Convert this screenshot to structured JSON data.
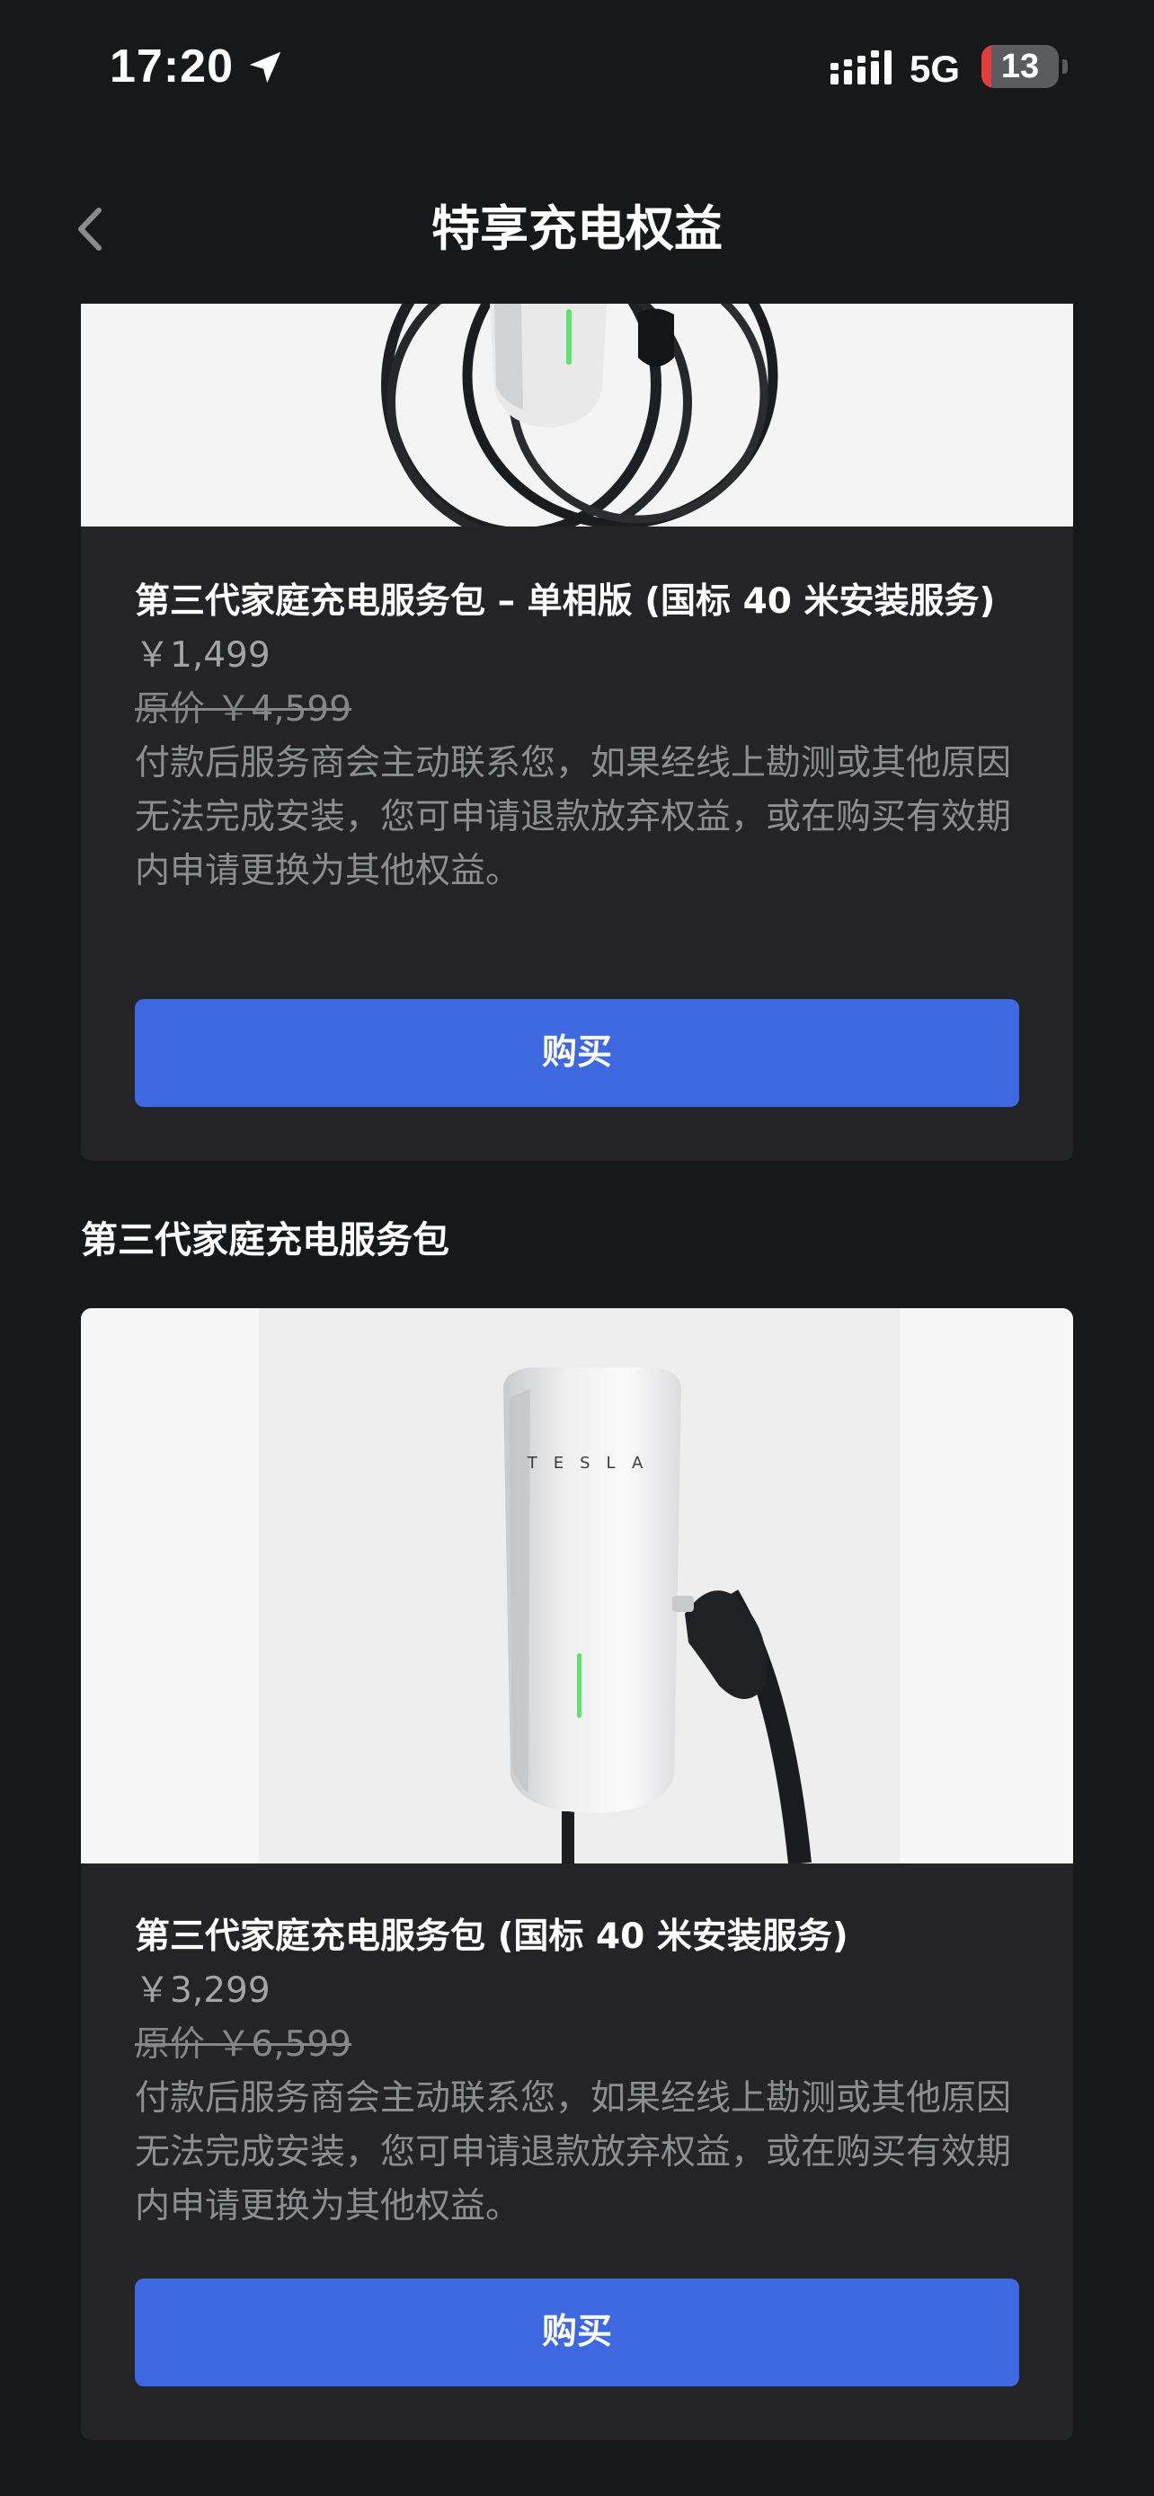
{
  "status_bar": {
    "time": "17:20",
    "network": "5G",
    "battery_level": "13",
    "battery_fraction": 0.13
  },
  "nav": {
    "title": "特享充电权益",
    "back_icon": "chevron-left-icon"
  },
  "products": [
    {
      "title": "第三代家庭充电服务包 – 单相版 (国标 40 米安装服务)",
      "price": "￥1,499",
      "original_price": "原价 ￥4,599",
      "description": "付款后服务商会主动联系您，如果经线上勘测或其他原因无法完成安装，您可申请退款放弃权益，或在购买有效期内申请更换为其他权益。",
      "buy_label": "购买"
    },
    {
      "title": "第三代家庭充电服务包 (国标 40 米安装服务)",
      "price": "￥3,299",
      "original_price": "原价 ￥6,599",
      "description": "付款后服务商会主动联系您，如果经线上勘测或其他原因无法完成安装，您可申请退款放弃权益，或在购买有效期内申请更换为其他权益。",
      "buy_label": "购买"
    }
  ],
  "section": {
    "header": "第三代家庭充电服务包"
  },
  "wall_connector_brand": "TESLA",
  "colors": {
    "background": "#17181a",
    "card": "#242426",
    "accent": "#3e68e0",
    "battery_low": "#e33d3d",
    "indicator_green": "#5fe36b"
  }
}
